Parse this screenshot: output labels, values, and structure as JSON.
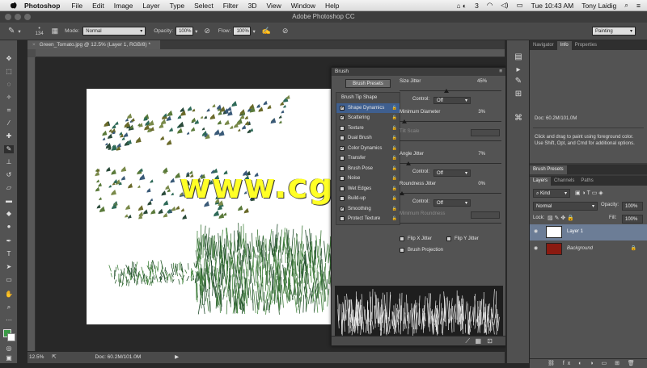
{
  "menubar": {
    "app": "Photoshop",
    "items": [
      "File",
      "Edit",
      "Image",
      "Layer",
      "Type",
      "Select",
      "Filter",
      "3D",
      "View",
      "Window",
      "Help"
    ],
    "badge": "3",
    "clock": "Tue 10:43 AM",
    "user": "Tony Laidig"
  },
  "titlebar": {
    "title": "Adobe Photoshop CC"
  },
  "options": {
    "brush_size": "134",
    "mode_label": "Mode:",
    "mode_value": "Normal",
    "opacity_label": "Opacity:",
    "opacity_value": "100%",
    "flow_label": "Flow:",
    "flow_value": "100%",
    "workspace": "Painting"
  },
  "document": {
    "tab": "Green_Tomato.jpg @ 12.5% (Layer 1, RGB/8) *",
    "zoom": "12.5%",
    "doc_size": "Doc: 60.2M/101.0M"
  },
  "brush_panel": {
    "title": "Brush",
    "presets_button": "Brush Presets",
    "tip_shape": "Brush Tip Shape",
    "options": [
      {
        "label": "Shape Dynamics",
        "checked": true,
        "selected": true
      },
      {
        "label": "Scattering",
        "checked": true
      },
      {
        "label": "Texture",
        "checked": false
      },
      {
        "label": "Dual Brush",
        "checked": false
      },
      {
        "label": "Color Dynamics",
        "checked": true
      },
      {
        "label": "Transfer",
        "checked": false
      },
      {
        "label": "Brush Pose",
        "checked": false
      },
      {
        "label": "Noise",
        "checked": false
      },
      {
        "label": "Wet Edges",
        "checked": false
      },
      {
        "label": "Build-up",
        "checked": false
      },
      {
        "label": "Smoothing",
        "checked": true
      },
      {
        "label": "Protect Texture",
        "checked": false
      }
    ],
    "size_jitter_label": "Size Jitter",
    "size_jitter_value": "45%",
    "control_label": "Control:",
    "control_value": "Off",
    "min_diameter_label": "Minimum Diameter",
    "min_diameter_value": "3%",
    "tilt_scale_label": "Tilt Scale",
    "angle_jitter_label": "Angle Jitter",
    "angle_jitter_value": "7%",
    "roundness_jitter_label": "Roundness Jitter",
    "roundness_jitter_value": "0%",
    "min_roundness_label": "Minimum Roundness",
    "flip_x": "Flip X Jitter",
    "flip_y": "Flip Y Jitter",
    "brush_projection": "Brush Projection"
  },
  "right_panels": {
    "top_tabs": [
      "Navigator",
      "Info",
      "Properties"
    ],
    "doc_info": "Doc: 60.2M/101.0M",
    "hint": "Click and drag to paint using foreground color. Use Shift, Opt, and Cmd for additional options.",
    "presets_tab": "Brush Presets",
    "layer_tabs": [
      "Layers",
      "Channels",
      "Paths"
    ],
    "kind": "Kind",
    "blend_mode": "Normal",
    "opacity_label": "Opacity:",
    "opacity_value": "100%",
    "lock_label": "Lock:",
    "fill_label": "Fill:",
    "fill_value": "100%",
    "layers": [
      {
        "name": "Layer 1",
        "selected": true
      },
      {
        "name": "Background",
        "selected": false
      }
    ]
  },
  "watermark": "www.cgtsj.com",
  "colors": {
    "selection": "#3f5f8f",
    "panel": "#535353",
    "watermark": "#ffff26"
  }
}
